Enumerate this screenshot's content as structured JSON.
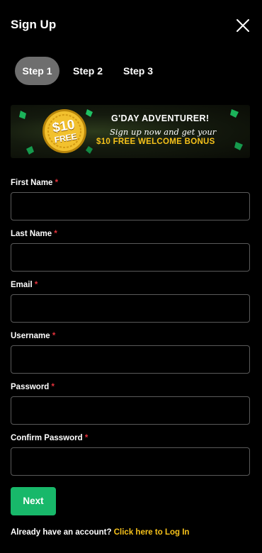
{
  "header": {
    "title": "Sign Up",
    "close_icon": "close-icon"
  },
  "steps": [
    {
      "label": "Step 1",
      "active": true
    },
    {
      "label": "Step 2",
      "active": false
    },
    {
      "label": "Step 3",
      "active": false
    }
  ],
  "banner": {
    "coin_amount": "$10",
    "coin_text": "FREE",
    "headline": "G'DAY ADVENTURER!",
    "tagline": "Sign up now and get your",
    "bonus": "$10 FREE WELCOME BONUS"
  },
  "form": {
    "required_mark": "*",
    "fields": [
      {
        "label": "First Name",
        "value": ""
      },
      {
        "label": "Last Name",
        "value": ""
      },
      {
        "label": "Email",
        "value": ""
      },
      {
        "label": "Username",
        "value": ""
      },
      {
        "label": "Password",
        "value": ""
      },
      {
        "label": "Confirm Password",
        "value": ""
      }
    ],
    "next_label": "Next"
  },
  "footer": {
    "question": "Already have an account?",
    "login_link": "Click here to Log In"
  },
  "colors": {
    "background": "#000000",
    "accent_green": "#18b86a",
    "link_gold": "#f7c21a",
    "required_red": "#e4323b"
  }
}
